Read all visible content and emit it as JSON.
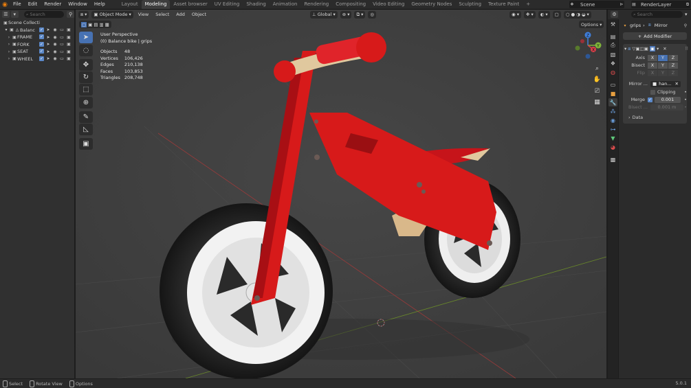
{
  "topbar": {
    "menus": [
      "File",
      "Edit",
      "Render",
      "Window",
      "Help"
    ],
    "workspaces": [
      "Layout",
      "Modeling",
      "Asset browser",
      "UV Editing",
      "Shading",
      "Animation",
      "Rendering",
      "Compositing",
      "Video Editing",
      "Geometry Nodes",
      "Sculpting",
      "Texture Paint"
    ],
    "active_workspace": "Modeling",
    "add_workspace": "+",
    "scene": "Scene",
    "render_layer": "RenderLayer"
  },
  "outliner": {
    "search_placeholder": "Search",
    "root": "Scene Collecti",
    "items": [
      {
        "label": "Balanc",
        "indent": 1
      },
      {
        "label": "FRAME",
        "indent": 2
      },
      {
        "label": "FORK",
        "indent": 2
      },
      {
        "label": "SEAT",
        "indent": 2
      },
      {
        "label": "WHEEL",
        "indent": 2
      }
    ]
  },
  "viewport": {
    "mode": "Object Mode",
    "menus": [
      "View",
      "Select",
      "Add",
      "Object"
    ],
    "transform_orientation": "Global",
    "options": "Options",
    "perspective": "User Perspective",
    "context": "(0) Balance bike | grips",
    "stats": [
      {
        "label": "Objects",
        "value": "48"
      },
      {
        "label": "Vertices",
        "value": "106,426"
      },
      {
        "label": "Edges",
        "value": "210,138"
      },
      {
        "label": "Faces",
        "value": "103,853"
      },
      {
        "label": "Triangles",
        "value": "208,748"
      }
    ],
    "gizmo": {
      "x": "X",
      "y": "Y",
      "z": "Z"
    }
  },
  "properties": {
    "search_placeholder": "Search",
    "breadcrumb_object": "grips",
    "breadcrumb_modifier": "Mirror",
    "add_modifier": "Add Modifier",
    "mirror": {
      "axis_label": "Axis",
      "bisect_label": "Bisect",
      "flip_label": "Flip",
      "mirror_object_label": "Mirror ...",
      "mirror_object_value": "han...",
      "clipping_label": "Clipping",
      "merge_label": "Merge",
      "merge_value": "0.001",
      "bisect_dist_label": "Bisect ...",
      "bisect_dist_value": "0.001 m",
      "data_label": "Data",
      "x": "X",
      "y": "Y",
      "z": "Z"
    }
  },
  "status": {
    "select": "Select",
    "rotate": "Rotate View",
    "options": "Options",
    "version": "5.0.1"
  },
  "colors": {
    "accent": "#4772b3",
    "bike_red": "#d71a1a",
    "blender_orange": "#e87d0d"
  }
}
